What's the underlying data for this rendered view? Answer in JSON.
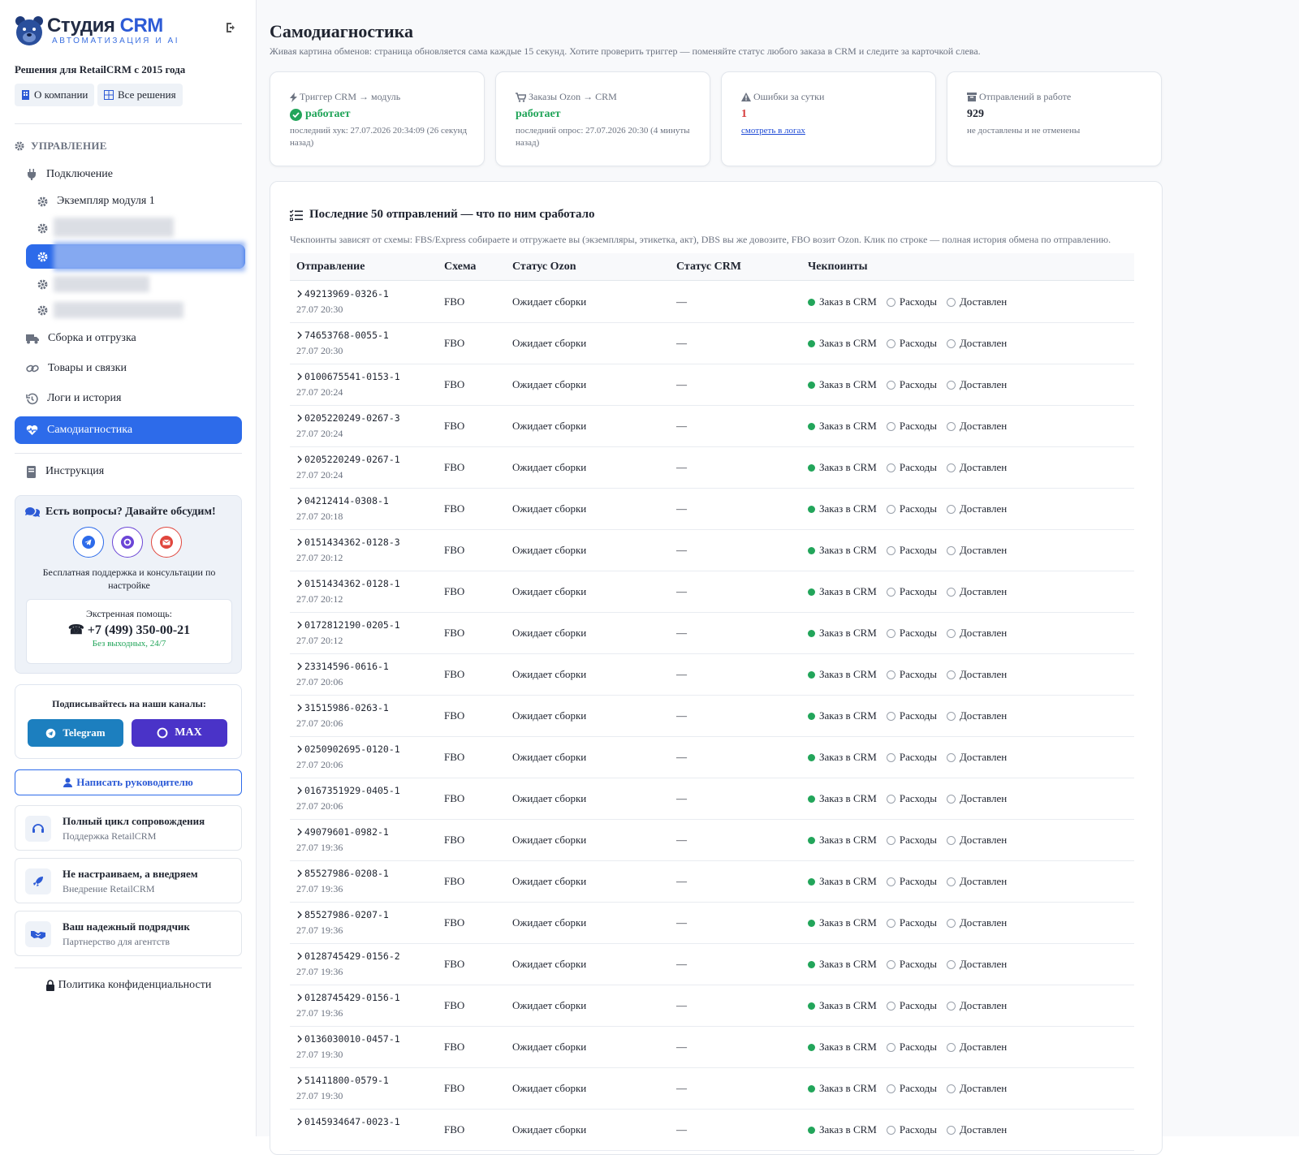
{
  "brand": {
    "name_main": "Студия",
    "name_accent": "CRM",
    "subtitle": "АВТОМАТИЗАЦИЯ И AI",
    "tagline": "Решения для RetailCRM с 2015 года"
  },
  "top_links": {
    "about": "О компании",
    "solutions": "Все решения"
  },
  "sidebar": {
    "section_title": "УПРАВЛЕНИЕ",
    "connection": "Подключение",
    "instance": "Экземпляр модуля 1",
    "assembly": "Сборка и отгрузка",
    "products": "Товары и связки",
    "logs": "Логи и история",
    "diagnostics": "Самодиагностика",
    "instructions": "Инструкция"
  },
  "contact": {
    "title": "Есть вопросы? Давайте обсудим!",
    "note": "Бесплатная поддержка и консультации по настройке",
    "emergency_label": "Экстренная помощь:",
    "phone": "+7 (499) 350-00-21",
    "schedule": "Без выходных, 24/7"
  },
  "subscribe": {
    "title": "Подписывайтесь на наши каналы:",
    "telegram": "Telegram",
    "max": "MAX"
  },
  "write_manager": "Написать руководителю",
  "promos": [
    {
      "title": "Полный цикл сопровождения",
      "sub": "Поддержка RetailCRM"
    },
    {
      "title": "Не настраиваем, а внедряем",
      "sub": "Внедрение RetailCRM"
    },
    {
      "title": "Ваш надежный подрядчик",
      "sub": "Партнерство для агентств"
    }
  ],
  "policy": "Политика конфиденциальности",
  "page": {
    "title": "Самодиагностика",
    "intro": "Живая картина обменов: страница обновляется сама каждые 15 секунд. Хотите проверить триггер — поменяйте статус любого заказа в CRM и следите за карточкой слева."
  },
  "cards": [
    {
      "label": "Триггер CRM → модуль",
      "value": "работает",
      "note": "последний хук: 27.07.2026 20:34:09 (26 секунд назад)"
    },
    {
      "label": "Заказы Ozon → CRM",
      "value": "работает",
      "note": "последний опрос: 27.07.2026 20:30 (4 минуты назад)"
    },
    {
      "label": "Ошибки за сутки",
      "value": "1",
      "note": "смотреть в логах"
    },
    {
      "label": "Отправлений в работе",
      "value": "929",
      "note": "не доставлены и не отменены"
    }
  ],
  "colors": {
    "accent": "#2d6bea",
    "ok": "#22a55a",
    "error": "#d63a3a"
  },
  "table": {
    "title": "Последние 50 отправлений — что по ним сработало",
    "note": "Чекпоинты зависят от схемы: FBS/Express собираете и отгружаете вы (экземпляры, этикетка, акт), DBS вы же довозите, FBO возит Ozon. Клик по строке — полная история обмена по отправлению.",
    "headers": {
      "shipment": "Отправление",
      "scheme": "Схема",
      "ozon": "Статус Ozon",
      "crm": "Статус CRM",
      "checkpoints": "Чекпоинты"
    },
    "checkpoints": [
      "Заказ в CRM",
      "Расходы",
      "Доставлен"
    ],
    "rows": [
      {
        "id": "49213969-0326-1",
        "date": "27.07 20:30",
        "scheme": "FBO",
        "ozon": "Ожидает сборки",
        "crm": "—"
      },
      {
        "id": "74653768-0055-1",
        "date": "27.07 20:30",
        "scheme": "FBO",
        "ozon": "Ожидает сборки",
        "crm": "—"
      },
      {
        "id": "0100675541-0153-1",
        "date": "27.07 20:24",
        "scheme": "FBO",
        "ozon": "Ожидает сборки",
        "crm": "—"
      },
      {
        "id": "0205220249-0267-3",
        "date": "27.07 20:24",
        "scheme": "FBO",
        "ozon": "Ожидает сборки",
        "crm": "—"
      },
      {
        "id": "0205220249-0267-1",
        "date": "27.07 20:24",
        "scheme": "FBO",
        "ozon": "Ожидает сборки",
        "crm": "—"
      },
      {
        "id": "04212414-0308-1",
        "date": "27.07 20:18",
        "scheme": "FBO",
        "ozon": "Ожидает сборки",
        "crm": "—"
      },
      {
        "id": "0151434362-0128-3",
        "date": "27.07 20:12",
        "scheme": "FBO",
        "ozon": "Ожидает сборки",
        "crm": "—"
      },
      {
        "id": "0151434362-0128-1",
        "date": "27.07 20:12",
        "scheme": "FBO",
        "ozon": "Ожидает сборки",
        "crm": "—"
      },
      {
        "id": "0172812190-0205-1",
        "date": "27.07 20:12",
        "scheme": "FBO",
        "ozon": "Ожидает сборки",
        "crm": "—"
      },
      {
        "id": "23314596-0616-1",
        "date": "27.07 20:06",
        "scheme": "FBO",
        "ozon": "Ожидает сборки",
        "crm": "—"
      },
      {
        "id": "31515986-0263-1",
        "date": "27.07 20:06",
        "scheme": "FBO",
        "ozon": "Ожидает сборки",
        "crm": "—"
      },
      {
        "id": "0250902695-0120-1",
        "date": "27.07 20:06",
        "scheme": "FBO",
        "ozon": "Ожидает сборки",
        "crm": "—"
      },
      {
        "id": "0167351929-0405-1",
        "date": "27.07 20:06",
        "scheme": "FBO",
        "ozon": "Ожидает сборки",
        "crm": "—"
      },
      {
        "id": "49079601-0982-1",
        "date": "27.07 19:36",
        "scheme": "FBO",
        "ozon": "Ожидает сборки",
        "crm": "—"
      },
      {
        "id": "85527986-0208-1",
        "date": "27.07 19:36",
        "scheme": "FBO",
        "ozon": "Ожидает сборки",
        "crm": "—"
      },
      {
        "id": "85527986-0207-1",
        "date": "27.07 19:36",
        "scheme": "FBO",
        "ozon": "Ожидает сборки",
        "crm": "—"
      },
      {
        "id": "0128745429-0156-2",
        "date": "27.07 19:36",
        "scheme": "FBO",
        "ozon": "Ожидает сборки",
        "crm": "—"
      },
      {
        "id": "0128745429-0156-1",
        "date": "27.07 19:36",
        "scheme": "FBO",
        "ozon": "Ожидает сборки",
        "crm": "—"
      },
      {
        "id": "0136030010-0457-1",
        "date": "27.07 19:30",
        "scheme": "FBO",
        "ozon": "Ожидает сборки",
        "crm": "—"
      },
      {
        "id": "51411800-0579-1",
        "date": "27.07 19:30",
        "scheme": "FBO",
        "ozon": "Ожидает сборки",
        "crm": "—"
      },
      {
        "id": "0145934647-0023-1",
        "date": "",
        "scheme": "FBO",
        "ozon": "Ожидает сборки",
        "crm": "—"
      }
    ]
  }
}
